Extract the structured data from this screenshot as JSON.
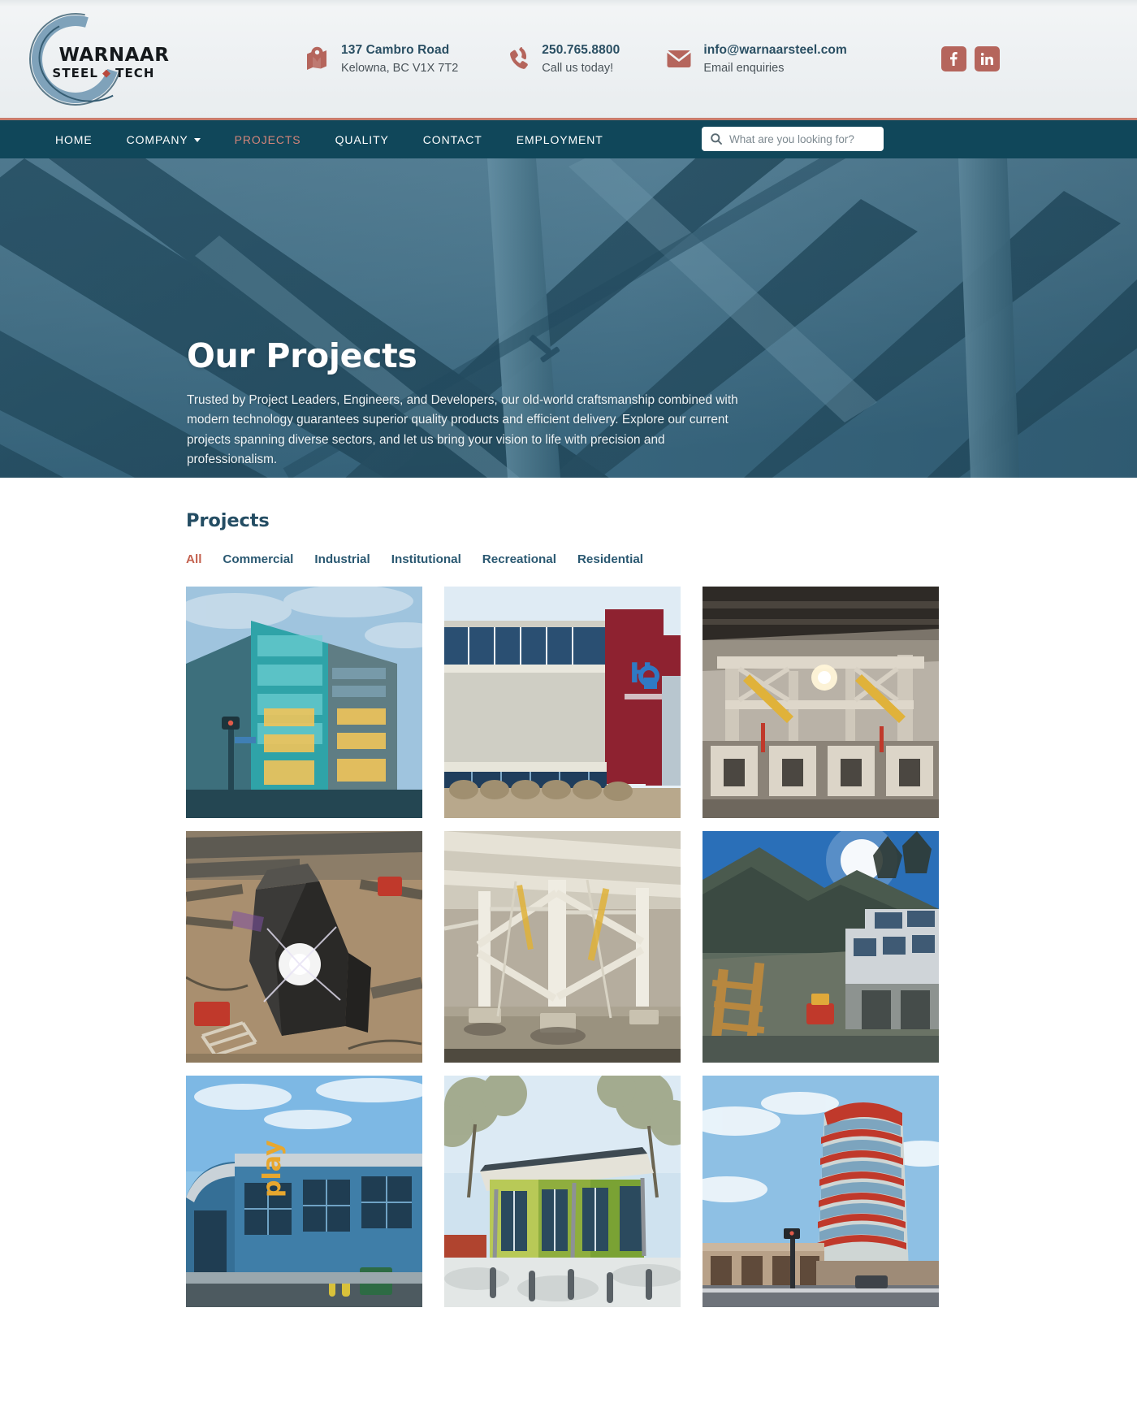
{
  "header": {
    "logo": {
      "top_text": "WARNAAR",
      "bottom_text_left": "STEEL",
      "bottom_text_right": "TECH",
      "diamond": "◆"
    },
    "contacts": [
      {
        "icon": "map-pin-icon",
        "title": "137 Cambro Road",
        "sub": "Kelowna, BC V1X 7T2"
      },
      {
        "icon": "phone-icon",
        "title": "250.765.8800",
        "sub": "Call us today!"
      },
      {
        "icon": "envelope-icon",
        "title": "info@warnaarsteel.com",
        "sub": "Email enquiries"
      }
    ],
    "social": [
      {
        "icon": "facebook-icon",
        "label": "f"
      },
      {
        "icon": "linkedin-icon",
        "label": "in"
      }
    ]
  },
  "nav": {
    "items": [
      {
        "label": "HOME",
        "active": false,
        "has_caret": false
      },
      {
        "label": "COMPANY",
        "active": false,
        "has_caret": true
      },
      {
        "label": "PROJECTS",
        "active": true,
        "has_caret": false
      },
      {
        "label": "QUALITY",
        "active": false,
        "has_caret": false
      },
      {
        "label": "CONTACT",
        "active": false,
        "has_caret": false
      },
      {
        "label": "EMPLOYMENT",
        "active": false,
        "has_caret": false
      }
    ],
    "search": {
      "icon": "search-icon",
      "placeholder": "What are you looking for?",
      "value": ""
    }
  },
  "hero": {
    "title": "Our Projects",
    "description": "Trusted by Project Leaders, Engineers, and Developers, our old-world craftsmanship combined with modern technology guarantees superior quality products and efficient delivery. Explore our current projects spanning diverse sectors, and let us bring your vision to life with precision and professionalism."
  },
  "projects_section": {
    "title": "Projects",
    "filters": [
      {
        "label": "All",
        "active": true
      },
      {
        "label": "Commercial",
        "active": false
      },
      {
        "label": "Industrial",
        "active": false
      },
      {
        "label": "Institutional",
        "active": false
      },
      {
        "label": "Recreational",
        "active": false
      },
      {
        "label": "Residential",
        "active": false
      }
    ],
    "tiles": [
      {
        "name": "glass-office-building"
      },
      {
        "name": "red-facade-h2o-centre"
      },
      {
        "name": "industrial-interior-steel-frame"
      },
      {
        "name": "welding-fabrication-yard"
      },
      {
        "name": "structural-steel-columns-site"
      },
      {
        "name": "hillside-construction-sunny"
      },
      {
        "name": "blue-play-building"
      },
      {
        "name": "school-canopy-entrance"
      },
      {
        "name": "red-curved-highrise"
      }
    ]
  },
  "colors": {
    "nav_bg": "#10475a",
    "accent_red": "#c4624f",
    "accent_muted_red": "#b5655c",
    "brand_teal": "#244d63",
    "hero_overlay": "#2a5c73"
  }
}
